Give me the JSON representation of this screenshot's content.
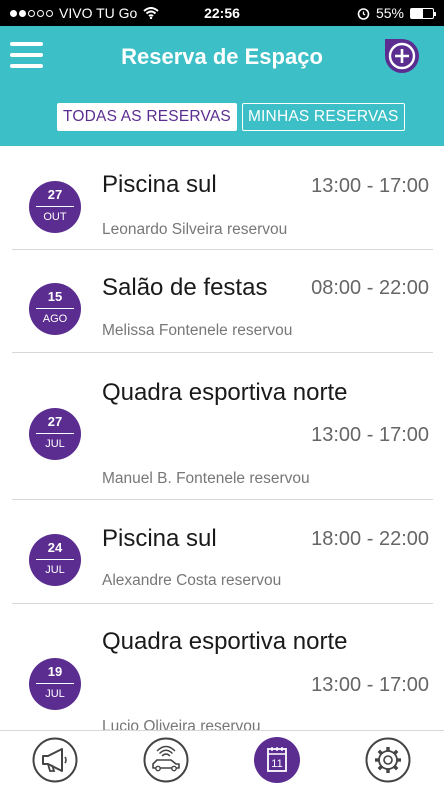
{
  "status_bar": {
    "carrier": "VIVO TU Go",
    "time": "22:56",
    "battery_percent": "55%",
    "battery_level": 0.55,
    "signal_bars": 2,
    "icons": [
      "wifi-icon",
      "alarm-icon",
      "battery-icon"
    ]
  },
  "header": {
    "title": "Reserva de Espaço",
    "menu_icon": "hamburger-menu-icon",
    "add_icon": "add-reservation-icon",
    "background": "#3cbfc6"
  },
  "tabs": [
    {
      "label": "TODAS AS RESERVAS",
      "active": true
    },
    {
      "label": "MINHAS RESERVAS",
      "active": false
    }
  ],
  "accent_color": "#5b2d91",
  "reservations": [
    {
      "day": "27",
      "month": "OUT",
      "title": "Piscina sul",
      "time": "13:00 - 17:00",
      "user": "Leonardo Silveira reservou"
    },
    {
      "day": "15",
      "month": "AGO",
      "title": "Salão de festas",
      "time": "08:00 - 22:00",
      "user": "Melissa Fontenele reservou"
    },
    {
      "day": "27",
      "month": "JUL",
      "title": "Quadra esportiva norte",
      "time": "13:00 - 17:00",
      "user": "Manuel B. Fontenele reservou"
    },
    {
      "day": "24",
      "month": "JUL",
      "title": "Piscina sul",
      "time": "18:00 - 22:00",
      "user": "Alexandre Costa reservou"
    },
    {
      "day": "19",
      "month": "JUL",
      "title": "Quadra esportiva norte",
      "time": "13:00 - 17:00",
      "user": "Lucio Oliveira reservou"
    }
  ],
  "bottom_nav": [
    {
      "icon": "megaphone-icon",
      "active": false
    },
    {
      "icon": "car-gate-icon",
      "active": false
    },
    {
      "icon": "calendar-icon",
      "label": "11",
      "active": true
    },
    {
      "icon": "gear-icon",
      "active": false
    }
  ]
}
